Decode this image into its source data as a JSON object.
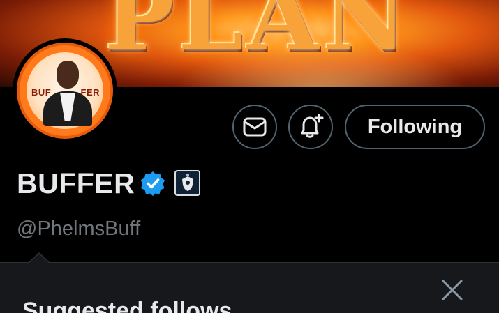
{
  "banner": {
    "text": "PLAN"
  },
  "avatar": {
    "word_left": "BUF",
    "word_right": "FER"
  },
  "actions": {
    "message_icon": "envelope-icon",
    "notify_icon": "bell-plus-icon",
    "follow_label": "Following"
  },
  "profile": {
    "name": "BUFFER",
    "verified_icon": "verified-badge-icon",
    "affiliate_icon": "shield-badge-icon",
    "handle": "@PhelmsBuff"
  },
  "suggested": {
    "title": "Suggested follows",
    "close_icon": "close-icon"
  },
  "colors": {
    "background": "#000000",
    "verified": "#1d9bf0",
    "border": "#536471",
    "muted": "#71767b",
    "panel": "#16181c"
  }
}
